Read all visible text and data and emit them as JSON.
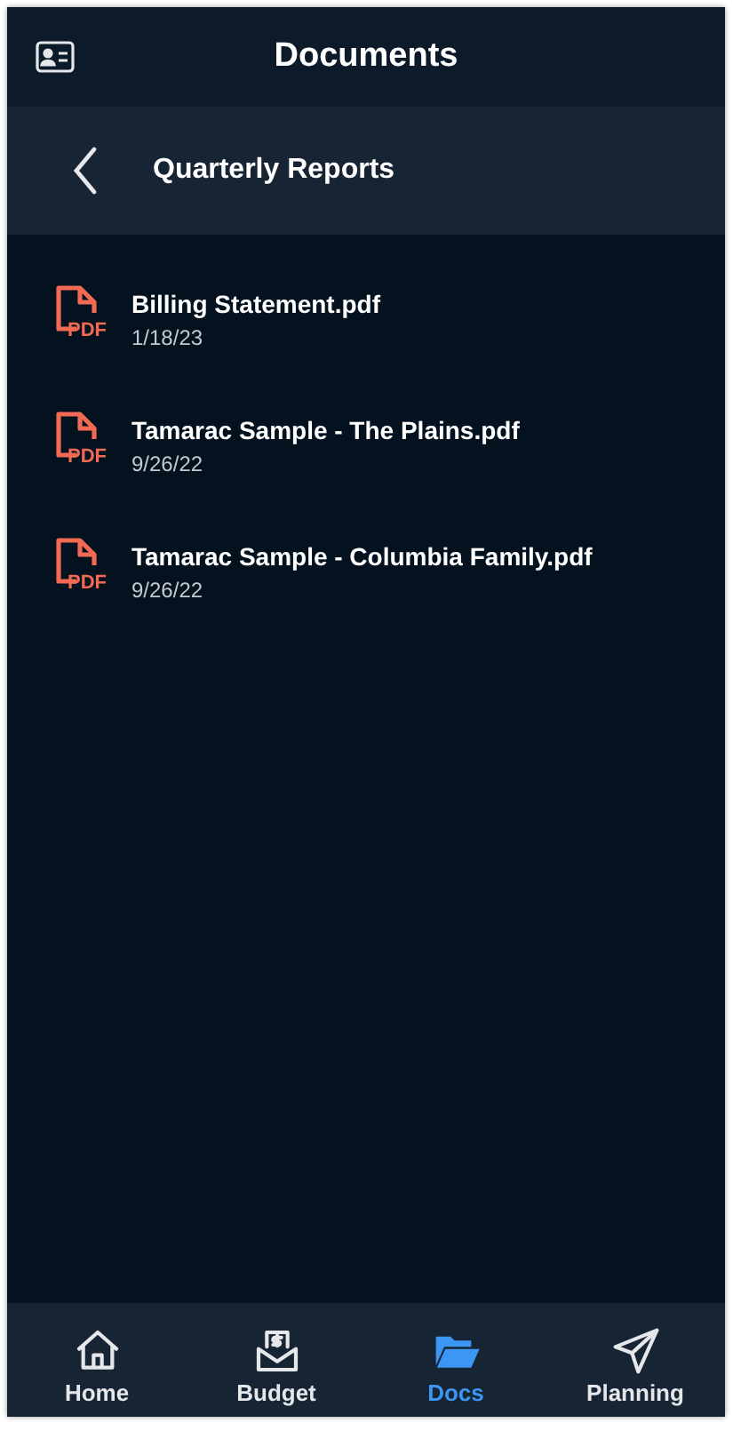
{
  "header": {
    "title": "Documents"
  },
  "folder": {
    "title": "Quarterly Reports"
  },
  "documents": [
    {
      "name": "Billing Statement.pdf",
      "date": "1/18/23",
      "badge": "PDF"
    },
    {
      "name": "Tamarac Sample - The Plains.pdf",
      "date": "9/26/22",
      "badge": "PDF"
    },
    {
      "name": "Tamarac Sample - Columbia Family.pdf",
      "date": "9/26/22",
      "badge": "PDF"
    }
  ],
  "nav": [
    {
      "label": "Home",
      "selected": false
    },
    {
      "label": "Budget",
      "selected": false
    },
    {
      "label": "Docs",
      "selected": true
    },
    {
      "label": "Planning",
      "selected": false
    }
  ]
}
